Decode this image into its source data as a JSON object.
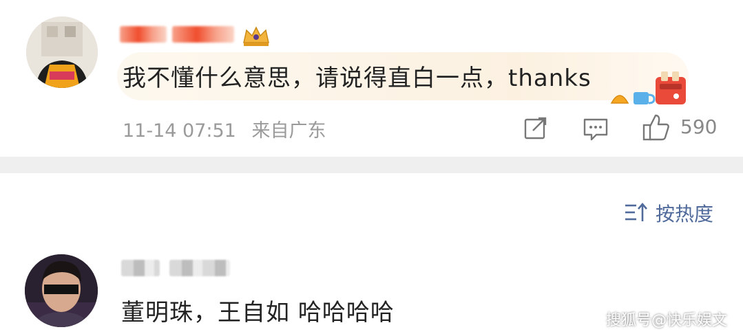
{
  "comments": [
    {
      "text": "我不懂什么意思，请说得直白一点，thanks",
      "date": "11-14 07:51",
      "location": "来自广东",
      "likes": "590"
    },
    {
      "text": "董明珠，王自如 哈哈哈哈"
    }
  ],
  "sort": {
    "label": "按热度"
  },
  "watermark": "搜狐号@快乐娱文",
  "icons": [
    "share-icon",
    "comment-icon",
    "like-icon",
    "sort-icon",
    "crown-badge-icon",
    "toast-sticker-icon"
  ],
  "colors": {
    "accent": "#4f6a9a",
    "meta": "#9a9a9a",
    "divider": "#efefef"
  }
}
